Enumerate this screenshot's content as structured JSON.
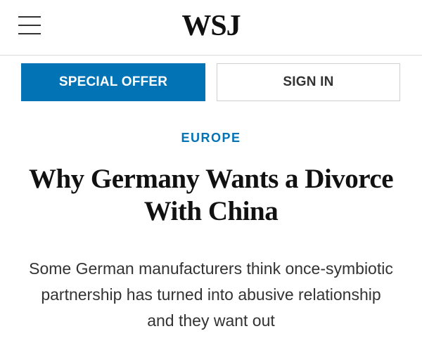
{
  "header": {
    "menu_icon": "hamburger-menu-icon",
    "logo": "WSJ"
  },
  "actions": {
    "special_offer_label": "SPECIAL OFFER",
    "sign_in_label": "SIGN IN"
  },
  "article": {
    "section": "EUROPE",
    "headline": "Why Germany Wants a Divorce With China",
    "dek": "Some German manufacturers think once-symbiotic partnership has turned into abusive relationship and they want out"
  },
  "colors": {
    "accent": "#0274b6",
    "text": "#111111",
    "border": "#cfcfcf"
  }
}
